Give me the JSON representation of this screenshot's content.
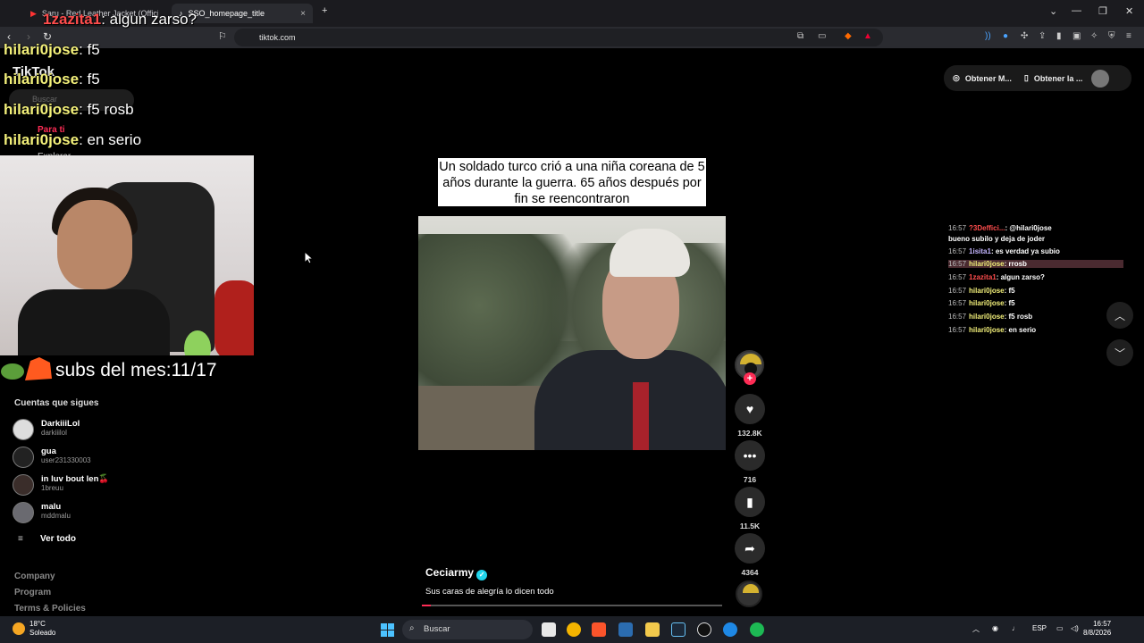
{
  "browser": {
    "tabs": [
      {
        "title": "Saru - Red Leather Jacket (Official Vi",
        "close": "×"
      },
      {
        "title": "SSO_homepage_title",
        "close": "×"
      }
    ],
    "new_tab": "+",
    "window_controls": [
      "⌄",
      "—",
      "❐",
      "✕"
    ],
    "url": "tiktok.com"
  },
  "tiktok": {
    "logo": "TikTok",
    "search_placeholder": "Buscar",
    "nav": {
      "for_you": "Para ti",
      "explore": "Explorar"
    },
    "following_title": "Cuentas que sigues",
    "following": [
      {
        "name": "DarkiiiLol",
        "username": "darkiiilol"
      },
      {
        "name": "gua",
        "username": "user231330003"
      },
      {
        "name": "in luv bout len🍒",
        "username": "1breuu"
      },
      {
        "name": "malu",
        "username": "mddmalu"
      }
    ],
    "see_all": "Ver todo",
    "footer_links": [
      "Company",
      "Program",
      "Terms & Policies"
    ],
    "top_buttons": [
      "Obtener M...",
      "Obtener la ..."
    ],
    "video": {
      "caption": "Un soldado turco crió a una niña coreana de 5 años durante la guerra. 65 años después por fin se reencontraron",
      "author": "Ceciarmy",
      "description": "Sus caras de alegría lo dicen todo",
      "progress": 0.03
    },
    "actions": {
      "likes": "132.8K",
      "comments": "716",
      "saves": "11.5K",
      "shares": "4364"
    }
  },
  "stream_overlay": {
    "chat": [
      {
        "user": "1zazita1",
        "msg": ": algun zarso?"
      },
      {
        "user": "hilari0jose",
        "msg": ": f5"
      },
      {
        "user": "hilari0jose",
        "msg": ": f5"
      },
      {
        "user": "hilari0jose",
        "msg": ": f5 rosb"
      },
      {
        "user": "hilari0jose",
        "msg": ": en serio"
      }
    ],
    "subs": "subs del mes:11/17"
  },
  "side_chat": [
    {
      "time": "16:57",
      "user": "?3Deffici...",
      "msg": ": @hilari0jose"
    },
    {
      "time": "",
      "user": "",
      "msg": "bueno subilo y deja de joder"
    },
    {
      "time": "16:57",
      "user": "1isita1",
      "msg": ": es verdad ya subio"
    },
    {
      "time": "16:57",
      "user": "hilari0jose",
      "msg": ": rrosb"
    },
    {
      "time": "16:57",
      "user": "1zazita1",
      "msg": ": algun zarso?"
    },
    {
      "time": "16:57",
      "user": "hilari0jose",
      "msg": ": f5"
    },
    {
      "time": "16:57",
      "user": "hilari0jose",
      "msg": ": f5"
    },
    {
      "time": "16:57",
      "user": "hilari0jose",
      "msg": ": f5 rosb"
    },
    {
      "time": "16:57",
      "user": "hilari0jose",
      "msg": ": en serio"
    }
  ],
  "taskbar": {
    "weather_temp": "18°C",
    "weather_desc": "Soleado",
    "search": "Buscar",
    "lang": "ESP",
    "time": "16:57",
    "date": "8/8/2026"
  }
}
